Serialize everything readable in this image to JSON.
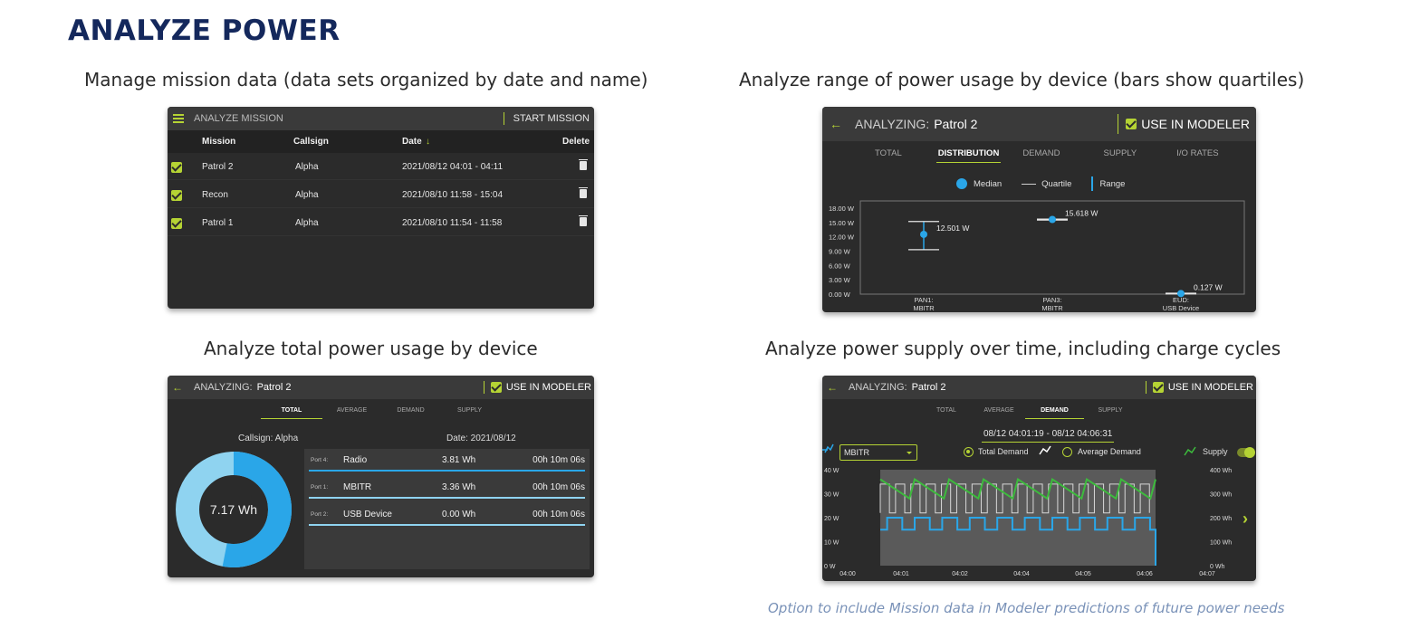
{
  "heading": "ANALYZE POWER",
  "captions": {
    "mission": "Manage mission data (data sets organized by date and name)",
    "range": "Analyze range of power usage by device (bars show quartiles)",
    "total": "Analyze total power usage by device",
    "supply": "Analyze power supply over time, including charge cycles"
  },
  "footnote": "Option to include Mission data in Modeler predictions of future power needs",
  "mission_panel": {
    "title": "ANALYZE MISSION",
    "start_label": "START MISSION",
    "columns": {
      "mission": "Mission",
      "callsign": "Callsign",
      "date": "Date",
      "date_sort": "↓",
      "delete": "Delete"
    },
    "rows": [
      {
        "mission": "Patrol 2",
        "callsign": "Alpha",
        "date": "2021/08/12 04:01 - 04:11"
      },
      {
        "mission": "Recon",
        "callsign": "Alpha",
        "date": "2021/08/10 11:58 - 15:04"
      },
      {
        "mission": "Patrol 1",
        "callsign": "Alpha",
        "date": "2021/08/10 11:54 - 11:58"
      }
    ]
  },
  "distribution_panel": {
    "analyzing_label": "ANALYZING:",
    "analyzing_value": "Patrol 2",
    "modeler_label": "USE IN MODELER",
    "tabs": [
      "TOTAL",
      "DISTRIBUTION",
      "DEMAND",
      "SUPPLY",
      "I/O RATES"
    ],
    "active_tab": "DISTRIBUTION",
    "legend": {
      "median": "Median",
      "quartile": "Quartile",
      "range": "Range"
    }
  },
  "chart_data": [
    {
      "type": "box",
      "y_ticks": [
        "18.00 W",
        "15.00 W",
        "12.00 W",
        "9.00 W",
        "6.00 W",
        "3.00 W",
        "0.00 W"
      ],
      "ylim": [
        0,
        19.5
      ],
      "categories": [
        {
          "line1": "PAN1:",
          "line2": "MBITR",
          "median": 12.501,
          "q1": 9.3,
          "q3": 15.2,
          "min": 9.3,
          "max": 15.2,
          "label": "12.501 W"
        },
        {
          "line1": "PAN3:",
          "line2": "MBITR",
          "median": 15.618,
          "q1": 15.5,
          "q3": 15.7,
          "min": 15.5,
          "max": 15.7,
          "label": "15.618 W"
        },
        {
          "line1": "EUD:",
          "line2": "USB Device",
          "median": 0.127,
          "q1": 0.05,
          "q3": 0.2,
          "min": 0.05,
          "max": 0.2,
          "label": "0.127 W"
        }
      ]
    },
    {
      "type": "line",
      "x_ticks": [
        "04:00",
        "04:01",
        "04:02",
        "04:04",
        "04:05",
        "04:06",
        "04:07"
      ],
      "y_left_ticks": [
        "40 W",
        "30 W",
        "20 W",
        "10 W",
        "0 W"
      ],
      "y_right_ticks": [
        "400 Wh",
        "300 Wh",
        "200 Wh",
        "100 Wh",
        "0 Wh"
      ],
      "series": [
        {
          "name": "Supply",
          "color": "#3dbb3d",
          "pattern": "sawtooth",
          "high": 360,
          "low": 280,
          "cycles": 8
        },
        {
          "name": "Total Demand",
          "color": "#2aa6e8",
          "pattern": "square",
          "high": 20,
          "low": 15,
          "cycles": 10
        }
      ]
    }
  ],
  "total_panel": {
    "analyzing_label": "ANALYZING:",
    "analyzing_value": "Patrol 2",
    "modeler_label": "USE IN MODELER",
    "tabs": [
      "TOTAL",
      "AVERAGE",
      "DEMAND",
      "SUPPLY"
    ],
    "callsign": "Callsign: Alpha",
    "date": "Date: 2021/08/12",
    "total": "7.17 Wh",
    "donut_share": 0.53,
    "ports": [
      {
        "port": "Port 4:",
        "device": "Radio",
        "energy": "3.81 Wh",
        "time": "00h 10m 06s"
      },
      {
        "port": "Port 1:",
        "device": "MBITR",
        "energy": "3.36 Wh",
        "time": "00h 10m 06s"
      },
      {
        "port": "Port 2:",
        "device": "USB Device",
        "energy": "0.00 Wh",
        "time": "00h 10m 06s"
      }
    ]
  },
  "demand_panel": {
    "analyzing_label": "ANALYZING:",
    "analyzing_value": "Patrol 2",
    "modeler_label": "USE IN MODELER",
    "tabs": [
      "TOTAL",
      "AVERAGE",
      "DEMAND",
      "SUPPLY"
    ],
    "range": "08/12 04:01:19 - 08/12 04:06:31",
    "device": "MBITR",
    "option_total": "Total Demand",
    "option_average": "Average Demand",
    "supply_label": "Supply"
  }
}
